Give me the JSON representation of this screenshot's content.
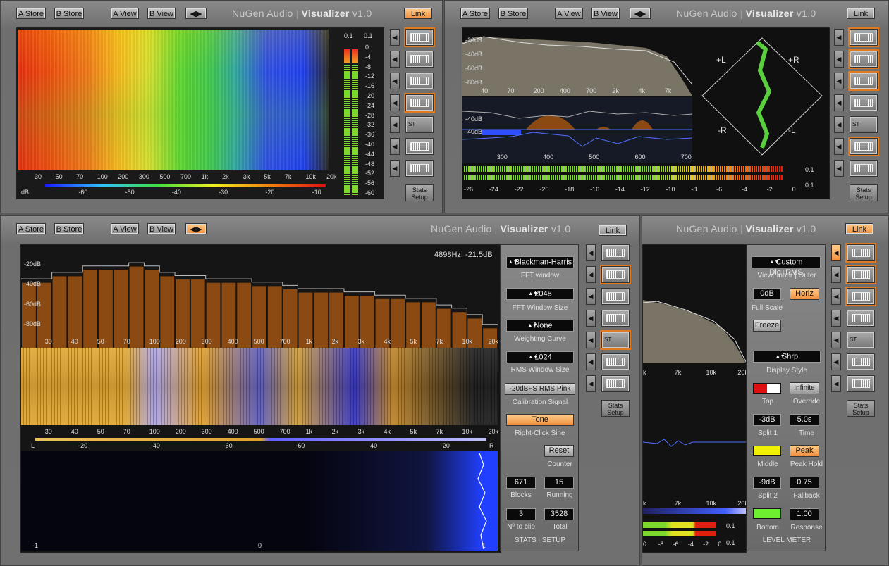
{
  "colors": {
    "accent": "#f09040",
    "spectrum_brown": "#8a4a12",
    "spectrum_gray": "#6e6a5a",
    "phase_green": "#6cff4a",
    "blue": "#3a5cff",
    "gold": "#e0a030"
  },
  "header_buttons": {
    "a_store": "A Store",
    "b_store": "B Store",
    "a_view": "A View",
    "b_view": "B View",
    "swap": "◀▶",
    "link": "Link"
  },
  "app_title": {
    "brand": "NuGen Audio",
    "separator": "|",
    "product": "Visualizer",
    "version": "v1.0"
  },
  "side_buttons": {
    "stats_line1": "Stats",
    "stats_line2": "Setup",
    "st": "ST",
    "icon_names": [
      "mode-bars-icon",
      "mode-spectrum-icon",
      "mode-small-spectrum-icon",
      "mode-fine-bars-icon",
      "stereo-icon",
      "plus-minus-diamond-icon",
      "phase-scale-icon"
    ]
  },
  "panel1": {
    "freq_ticks": [
      "30",
      "50",
      "70",
      "100",
      "200",
      "300",
      "500",
      "700",
      "1k",
      "2k",
      "3k",
      "5k",
      "7k",
      "10k",
      "20k"
    ],
    "db_label": "dB",
    "db_ticks": [
      "-60",
      "-50",
      "-40",
      "-30",
      "-20",
      "-10"
    ],
    "meter_top": [
      "0.1",
      "0.1"
    ],
    "meter_ticks": [
      "0",
      "-4",
      "-8",
      "-12",
      "-16",
      "-20",
      "-24",
      "-28",
      "-32",
      "-36",
      "-40",
      "-44",
      "-48",
      "-52",
      "-56",
      "-60"
    ]
  },
  "panel2": {
    "spec_db": [
      "-20dB",
      "-40dB",
      "-60dB",
      "-80dB"
    ],
    "spec_freq": [
      "40",
      "70",
      "200",
      "400",
      "700",
      "2k",
      "4k",
      "7k"
    ],
    "phase_db": [
      "-40dB",
      "-40dB"
    ],
    "phase_freq": [
      "300",
      "400",
      "500",
      "600",
      "700"
    ],
    "vector_labels": {
      "pl": "+L",
      "pr": "+R",
      "ml": "-L",
      "mr": "-R"
    },
    "meter_ticks": [
      "-26",
      "-24",
      "-22",
      "-20",
      "-18",
      "-16",
      "-14",
      "-12",
      "-10",
      "-8",
      "-6",
      "-4",
      "-2",
      "0"
    ],
    "meter_values": [
      "0.1",
      "0.1"
    ]
  },
  "panel3": {
    "readout": "4898Hz, -21.5dB",
    "spec_db": [
      "-20dB",
      "-40dB",
      "-60dB",
      "-80dB"
    ],
    "freq_ticks": [
      "30",
      "40",
      "50",
      "70",
      "100",
      "200",
      "300",
      "400",
      "500",
      "700",
      "1k",
      "2k",
      "3k",
      "4k",
      "5k",
      "7k",
      "10k",
      "20k"
    ],
    "balance": {
      "l": "L",
      "r": "R",
      "ticks": [
        "-20",
        "-40",
        "-60",
        "-60",
        "-40",
        "-20"
      ]
    },
    "bottom_ticks": {
      "left": "-1",
      "mid": "0",
      "right": "1"
    },
    "controls": {
      "fft_window": {
        "value": "Blackman-Harris",
        "label": "FFT window"
      },
      "fft_size": {
        "value": "2048",
        "label": "FFT Window Size"
      },
      "weighting": {
        "value": "None",
        "label": "Weighting Curve"
      },
      "rms_size": {
        "value": "1024",
        "label": "RMS Window Size"
      },
      "calibration": {
        "value": "-20dBFS RMS Pink",
        "label": "Calibration Signal"
      },
      "tone": {
        "value": "Tone",
        "label": "Right-Click Sine"
      },
      "reset": {
        "value": "Reset",
        "label": "Counter"
      },
      "blocks": {
        "value": "671",
        "label": "Blocks"
      },
      "running": {
        "value": "15",
        "label": "Running"
      },
      "to_clip": {
        "value": "3",
        "label": "Nº to clip"
      },
      "total": {
        "value": "3528",
        "label": "Total"
      },
      "footer": "STATS | SETUP"
    }
  },
  "panel4": {
    "spec_freq": [
      "k",
      "7k",
      "10k",
      "20k"
    ],
    "spec_freq2": [
      "k",
      "7k",
      "10k",
      "20k"
    ],
    "meter_ticks": [
      "0",
      "-8",
      "-6",
      "-4",
      "-2",
      "0"
    ],
    "meter_values": [
      "0.1",
      "0.1"
    ],
    "controls": {
      "view_value": "Custom Dig+RMS",
      "view_label": "View: Inner | Outer",
      "full_scale_value": "0dB",
      "horiz": "Horiz",
      "full_scale_label": "Full Scale",
      "freeze": "Freeze",
      "display_style_value": "Shrp",
      "display_style_label": "Display Style",
      "top_label": "Top",
      "infinite": "Infinite",
      "override_label": "Override",
      "split1_value": "-3dB",
      "split1_label": "Split 1",
      "time_value": "5.0s",
      "time_label": "Time",
      "middle_label": "Middle",
      "peak": "Peak",
      "peak_hold_label": "Peak Hold",
      "split2_value": "-9dB",
      "split2_label": "Split 2",
      "fallback_value": "0.75",
      "fallback_label": "Fallback",
      "bottom_label": "Bottom",
      "response_value": "1.00",
      "response_label": "Response",
      "footer": "LEVEL METER"
    }
  }
}
